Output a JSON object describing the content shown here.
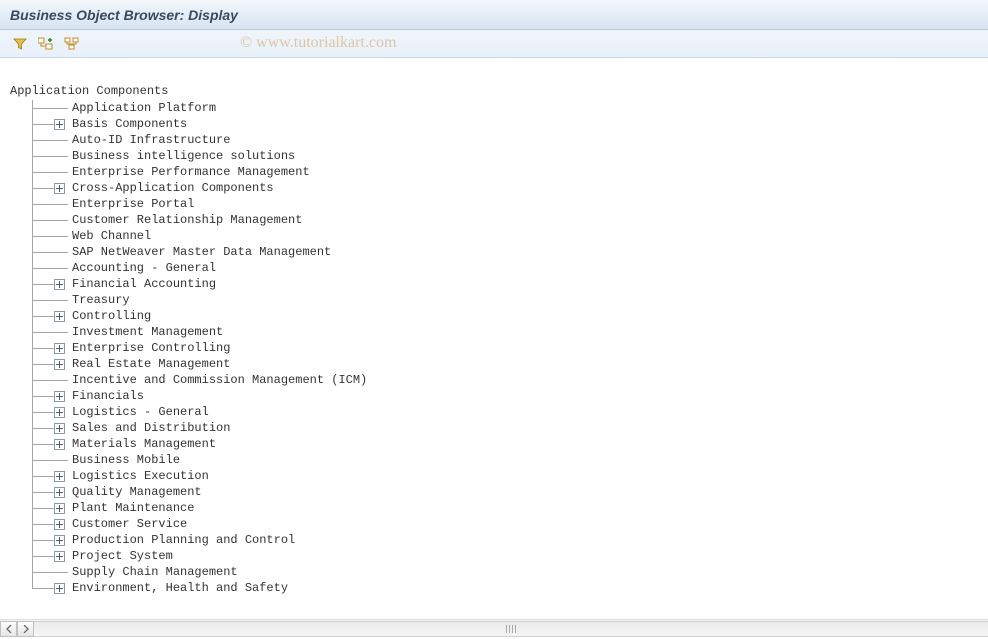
{
  "titlebar": {
    "title": "Business Object Browser: Display"
  },
  "watermark": "© www.tutorialkart.com",
  "toolbar": {
    "buttons": [
      {
        "name": "filter-icon"
      },
      {
        "name": "add-node-icon"
      },
      {
        "name": "expand-subtree-icon"
      }
    ]
  },
  "tree": {
    "root": "Application Components",
    "items": [
      {
        "label": "Application Platform",
        "expandable": false
      },
      {
        "label": "Basis Components",
        "expandable": true
      },
      {
        "label": "Auto-ID Infrastructure",
        "expandable": false
      },
      {
        "label": "Business intelligence solutions",
        "expandable": false
      },
      {
        "label": "Enterprise Performance Management",
        "expandable": false
      },
      {
        "label": "Cross-Application Components",
        "expandable": true
      },
      {
        "label": "Enterprise Portal",
        "expandable": false
      },
      {
        "label": "Customer Relationship Management",
        "expandable": false
      },
      {
        "label": "Web Channel",
        "expandable": false
      },
      {
        "label": "SAP NetWeaver Master Data Management",
        "expandable": false
      },
      {
        "label": "Accounting - General",
        "expandable": false
      },
      {
        "label": "Financial Accounting",
        "expandable": true
      },
      {
        "label": "Treasury",
        "expandable": false
      },
      {
        "label": "Controlling",
        "expandable": true
      },
      {
        "label": "Investment Management",
        "expandable": false
      },
      {
        "label": "Enterprise Controlling",
        "expandable": true
      },
      {
        "label": "Real Estate Management",
        "expandable": true
      },
      {
        "label": "Incentive and Commission Management (ICM)",
        "expandable": false
      },
      {
        "label": "Financials",
        "expandable": true
      },
      {
        "label": "Logistics - General",
        "expandable": true
      },
      {
        "label": "Sales and Distribution",
        "expandable": true
      },
      {
        "label": "Materials Management",
        "expandable": true
      },
      {
        "label": "Business Mobile",
        "expandable": false
      },
      {
        "label": "Logistics Execution",
        "expandable": true
      },
      {
        "label": "Quality Management",
        "expandable": true
      },
      {
        "label": "Plant Maintenance",
        "expandable": true
      },
      {
        "label": "Customer Service",
        "expandable": true
      },
      {
        "label": "Production Planning and Control",
        "expandable": true
      },
      {
        "label": "Project System",
        "expandable": true
      },
      {
        "label": "Supply Chain Management",
        "expandable": false
      },
      {
        "label": "Environment, Health and Safety",
        "expandable": true
      }
    ]
  }
}
